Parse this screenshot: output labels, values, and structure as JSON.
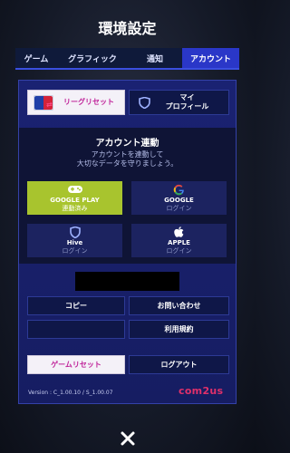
{
  "title": "環境設定",
  "tabs": [
    "ゲーム",
    "グラフィック",
    "通知",
    "アカウント"
  ],
  "active_tab": "アカウント",
  "account": {
    "league_reset_label": "リーグリセット",
    "my_profile_label_line1": "マイ",
    "my_profile_label_line2": "プロフィール",
    "link_title": "アカウント連動",
    "link_sub_line1": "アカウントを連動して",
    "link_sub_line2": "大切なデータを守りましょう。",
    "logins": [
      {
        "name": "GOOGLE PLAY",
        "status": "連動済み",
        "icon": "gamepad-icon"
      },
      {
        "name": "GOOGLE",
        "status": "ログイン",
        "icon": "google-icon"
      },
      {
        "name": "Hive",
        "status": "ログイン",
        "icon": "hive-shield-icon"
      },
      {
        "name": "APPLE",
        "status": "ログイン",
        "icon": "apple-icon"
      }
    ],
    "copy_label": "コピー",
    "contact_label": "お問い合わせ",
    "terms_label": "利用規約",
    "game_reset_label": "ゲームリセット",
    "logout_label": "ログアウト",
    "version": "Version : C_1.00.10 / S_1.00.07",
    "brand": "com2us"
  },
  "colors": {
    "active_tab": "#2a37c8",
    "linked_tile": "#a8c42e",
    "accent_pink": "#c0249a",
    "panel": "#1a2272"
  }
}
